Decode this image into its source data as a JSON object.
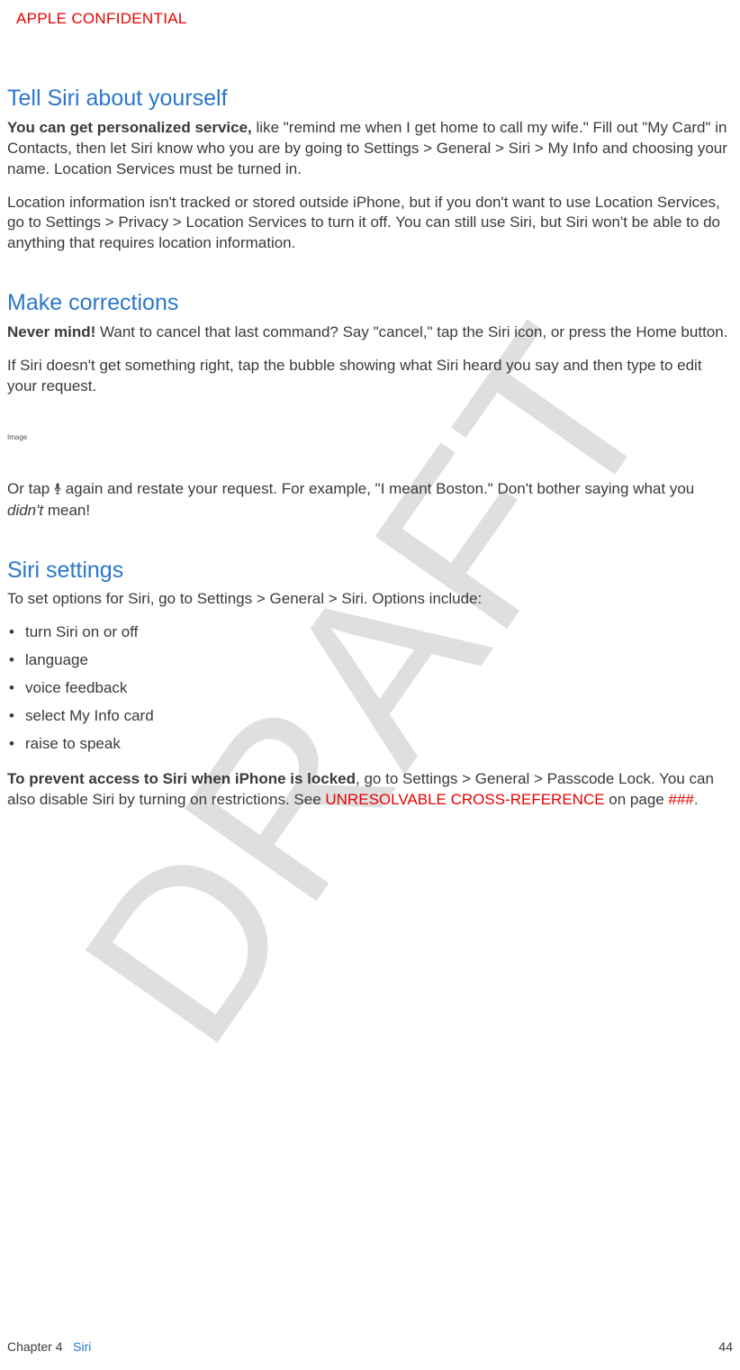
{
  "watermark": "DRAFT",
  "confidential": "APPLE CONFIDENTIAL",
  "sections": {
    "tell_siri": {
      "heading": "Tell Siri about yourself",
      "p1_bold": "You can get personalized service,",
      "p1_rest": " like \"remind me when I get home to call my wife.\" Fill out \"My Card\" in Contacts, then let Siri know who you are by going to Settings > General > Siri > My Info and choosing your name. Location Services must be turned in.",
      "p2": "Location information isn't tracked or stored outside iPhone, but if you don't want to use Location Services, go to Settings > Privacy > Location Services to turn it off. You can still use Siri, but Siri won't be able to do anything that requires location information."
    },
    "make_corrections": {
      "heading": "Make corrections",
      "p1_bold": "Never mind!",
      "p1_rest": " Want to cancel that last command? Say \"cancel,\" tap the Siri icon, or press the Home button.",
      "p2": "If Siri doesn't get something right, tap the bubble showing what Siri heard you say and then type to edit your request.",
      "image_label": "Image",
      "p3_a": "Or tap ",
      "p3_b": " again and restate your request. For example, \"I meant Boston.\" Don't bother saying what you ",
      "p3_italic": "didn't",
      "p3_c": " mean!"
    },
    "siri_settings": {
      "heading": "Siri settings",
      "intro": "To set options for Siri, go to Settings > General > Siri. Options include:",
      "items": [
        "turn Siri on or off",
        "language",
        "voice feedback",
        "select My Info card",
        "raise to speak"
      ],
      "p_bold": "To prevent access to Siri when iPhone is locked",
      "p_rest_a": ", go to Settings > General > Passcode Lock. You can also disable Siri by turning on restrictions. See ",
      "p_red1": "UNRESOLVABLE CROSS-REFERENCE",
      "p_rest_b": " on page ",
      "p_red2": "###",
      "p_rest_c": "."
    }
  },
  "footer": {
    "chapter_label": "Chapter  4",
    "chapter_title": "Siri",
    "page_number": "44"
  }
}
